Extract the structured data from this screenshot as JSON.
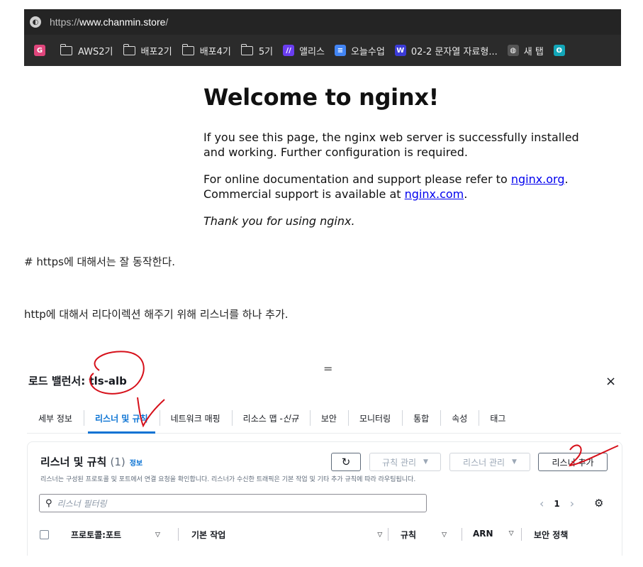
{
  "browser": {
    "url_scheme": "https://",
    "url_host": "www.chanmin.store",
    "url_path": "/",
    "bookmarks": [
      {
        "label": "",
        "icon": "grammarly-icon",
        "color": "#e0467c",
        "glyph": "G"
      },
      {
        "label": "AWS2기",
        "icon": "folder-icon"
      },
      {
        "label": "배포2기",
        "icon": "folder-icon"
      },
      {
        "label": "배포4기",
        "icon": "folder-icon"
      },
      {
        "label": "5기",
        "icon": "folder-icon"
      },
      {
        "label": "앨리스",
        "icon": "elice-icon",
        "color": "#6a3df0",
        "glyph": "//"
      },
      {
        "label": "오늘수업",
        "icon": "docs-icon",
        "color": "#4285f4",
        "glyph": "≡"
      },
      {
        "label": "02-2 문자열 자료형...",
        "icon": "wikidocs-icon",
        "color": "#3b3bd6",
        "glyph": "W"
      },
      {
        "label": "새 탭",
        "icon": "globe-icon",
        "color": "#555555",
        "glyph": "◍"
      },
      {
        "label": "",
        "icon": "app-icon",
        "color": "#12a6b8",
        "glyph": "ʘ"
      }
    ]
  },
  "nginx": {
    "title": "Welcome to nginx!",
    "p1": "If you see this page, the nginx web server is successfully installed and working. Further configuration is required.",
    "p2_prefix": "For online documentation and support please refer to ",
    "p2_link1": "nginx.org",
    "p2_mid": ".",
    "p2_line2_prefix": "Commercial support is available at ",
    "p2_link2": "nginx.com",
    "p2_end": ".",
    "p3": "Thank you for using nginx."
  },
  "notes": {
    "note1": "# https에 대해서는 잘 동작한다.",
    "note2": "http에 대해서 리다이렉션 해주기 위해 리스너를 하나 추가."
  },
  "console": {
    "drag_handle": "=",
    "lb_label": "로드 밸런서: ",
    "lb_name": "tls-alb",
    "close": "×",
    "tabs": [
      {
        "label": "세부 정보",
        "active": false
      },
      {
        "label": "리스너 및 규칙",
        "active": true
      },
      {
        "label": "네트워크 매핑",
        "active": false
      },
      {
        "label": "리소스 맵 - ",
        "suffix": "신규",
        "active": false
      },
      {
        "label": "보안",
        "active": false
      },
      {
        "label": "모니터링",
        "active": false
      },
      {
        "label": "통합",
        "active": false
      },
      {
        "label": "속성",
        "active": false
      },
      {
        "label": "태그",
        "active": false
      }
    ],
    "card": {
      "title": "리스너 및 규칙",
      "count": "(1)",
      "info": "정보",
      "description": "리스너는 구성된 프로토콜 및 포트에서 연결 요청을 확인합니다. 리스너가 수신한 트래픽은 기본 작업 및 기타 추가 규칙에 따라 라우팅됩니다.",
      "refresh": "C",
      "rule_manage": "규칙 관리",
      "listener_manage": "리스너 관리",
      "add_listener": "리스너 추가",
      "search_placeholder": "리스너 필터링",
      "page": "1"
    },
    "columns": [
      {
        "label": "프로토콜:포트"
      },
      {
        "label": "기본 작업"
      },
      {
        "label": "규칙"
      },
      {
        "label": "ARN"
      },
      {
        "label": "보안 정책"
      }
    ]
  },
  "colors": {
    "accent": "#0972d3",
    "annotation_red": "#d6101a",
    "link": "#0000ee"
  }
}
